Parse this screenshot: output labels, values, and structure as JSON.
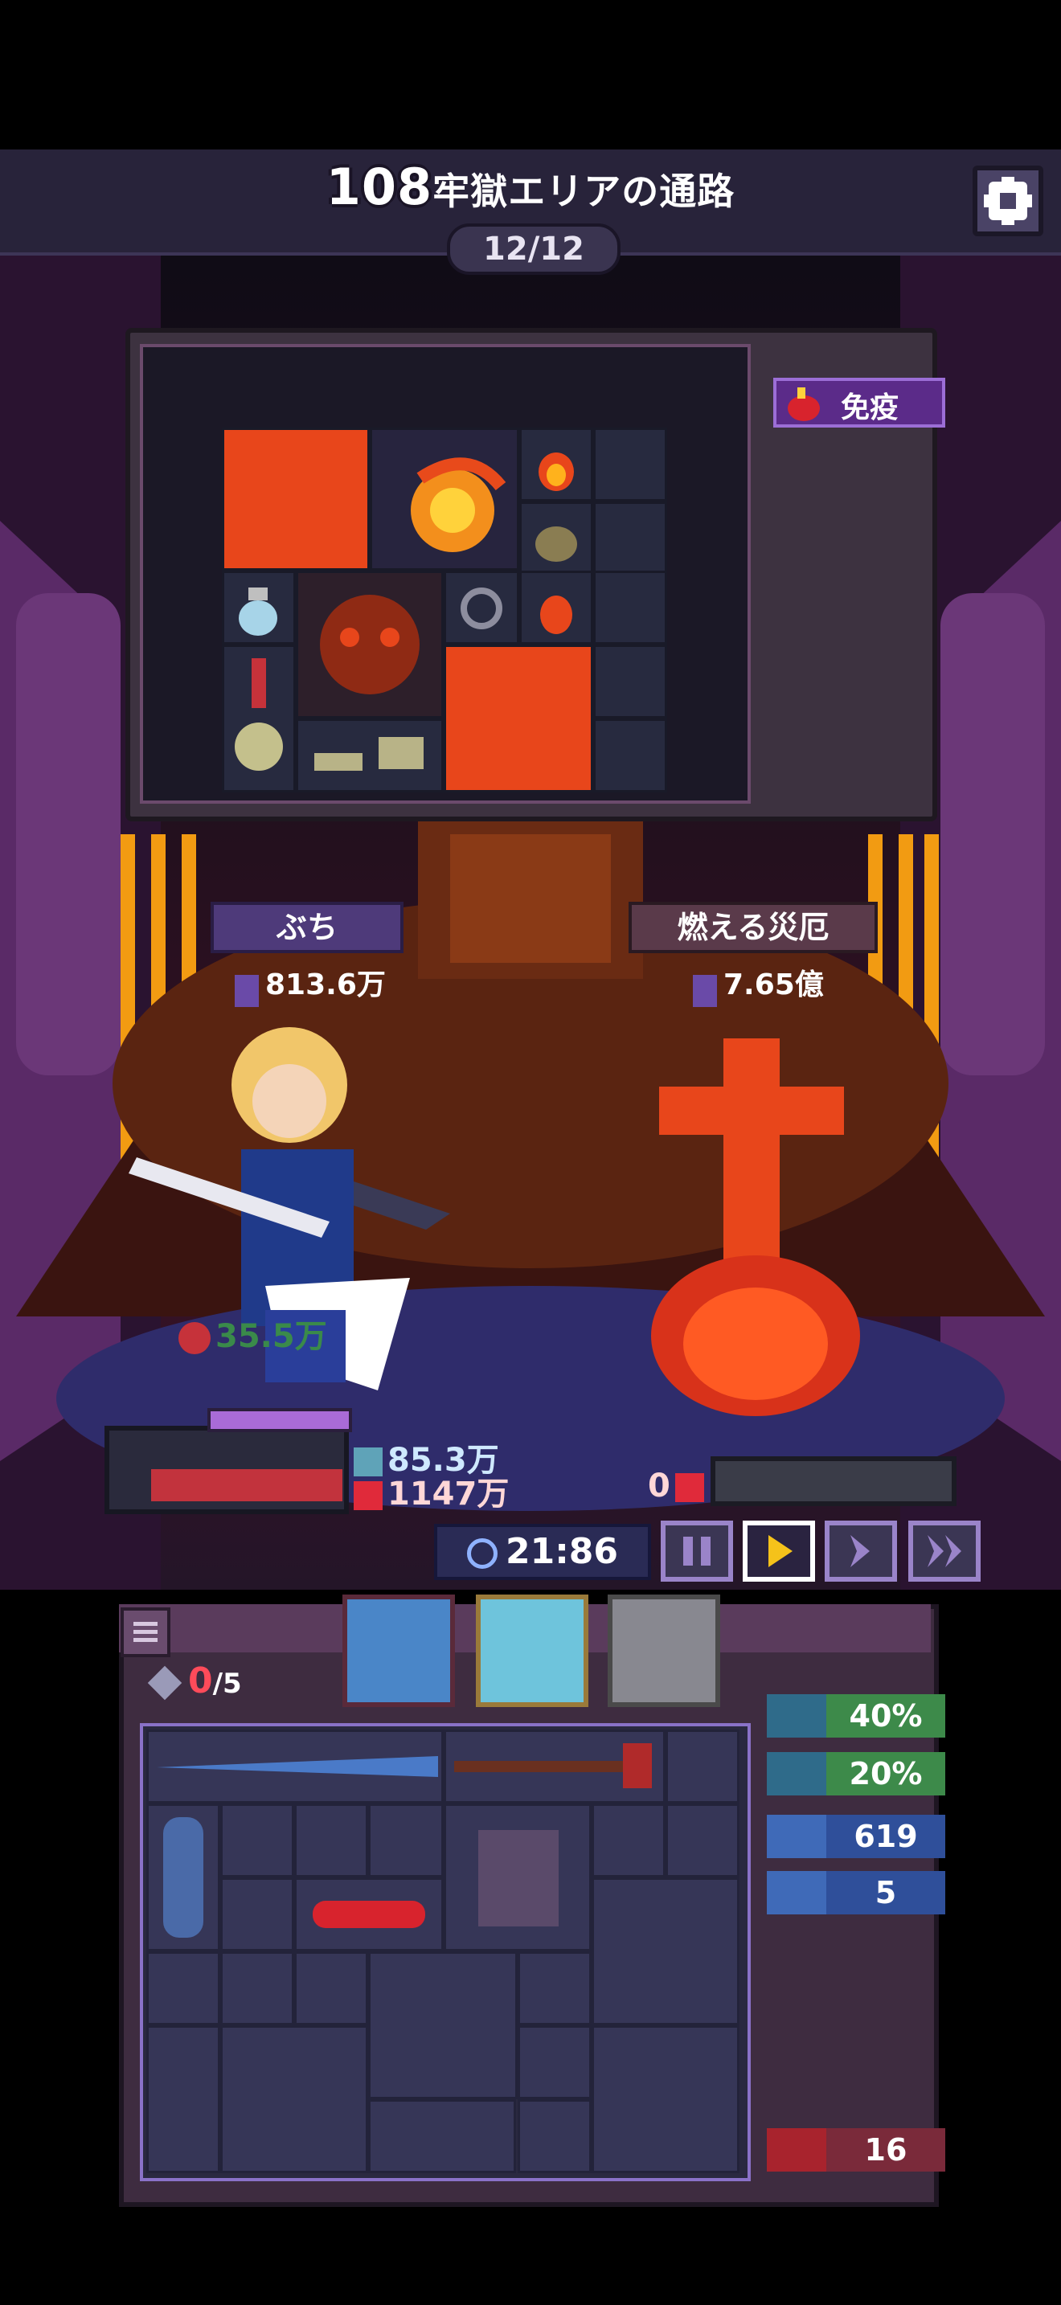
{
  "header": {
    "floor_number": "108",
    "area_name": "牢獄エリアの通路",
    "progress": "12/12"
  },
  "enemy_panel": {
    "status_badge": "免疫"
  },
  "player": {
    "name": "ぶち",
    "power": "813.6万",
    "poison_damage": "35.5万",
    "shield": "85.3万",
    "hp": "1147万"
  },
  "enemy": {
    "name": "燃える災厄",
    "power": "7.65億",
    "hp": "0"
  },
  "controls": {
    "timer": "21:86",
    "pause_icon": "pause-icon",
    "play_icon": "play-icon",
    "fast_icon": "fast-forward-icon",
    "faster_icon": "double-fast-forward-icon"
  },
  "inventory": {
    "slot_count": "0",
    "slot_max": "/5"
  },
  "stats": [
    {
      "name": "attack-speed",
      "value": "40%",
      "color": "#3d8a4a"
    },
    {
      "name": "crit-chance",
      "value": "20%",
      "color": "#3d8a4a"
    },
    {
      "name": "defense",
      "value": "619",
      "color": "#2f4f9a"
    },
    {
      "name": "lifesteal",
      "value": "5",
      "color": "#2f4f9a"
    },
    {
      "name": "burn",
      "value": "16",
      "color": "#7a2a3a"
    }
  ]
}
